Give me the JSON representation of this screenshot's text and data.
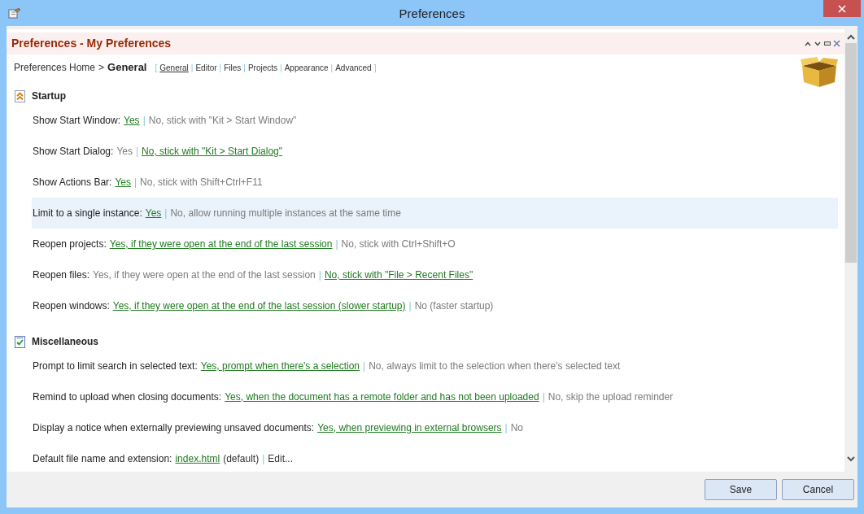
{
  "window": {
    "title": "Preferences"
  },
  "panel": {
    "title": "Preferences - My Preferences"
  },
  "breadcrumb": {
    "home": "Preferences Home",
    "separator": ">",
    "current": "General"
  },
  "nav": {
    "open": "[",
    "close": "]",
    "separator": "|",
    "items": [
      {
        "label": "General",
        "selected": true
      },
      {
        "label": "Editor",
        "selected": false
      },
      {
        "label": "Files",
        "selected": false
      },
      {
        "label": "Projects",
        "selected": false
      },
      {
        "label": "Appearance",
        "selected": false
      },
      {
        "label": "Advanced",
        "selected": false
      }
    ]
  },
  "sections": [
    {
      "title": "Startup",
      "kind": "collapse",
      "rows": [
        {
          "label": "Show Start Window:",
          "highlighted": false,
          "parts": [
            {
              "kind": "option",
              "text": "Yes",
              "selected": true
            },
            {
              "kind": "sep",
              "text": "|"
            },
            {
              "kind": "option",
              "text": "No, stick with \"Kit > Start Window\"",
              "selected": false
            }
          ]
        },
        {
          "label": "Show Start Dialog:",
          "highlighted": false,
          "parts": [
            {
              "kind": "option",
              "text": "Yes",
              "selected": false
            },
            {
              "kind": "sep",
              "text": "|"
            },
            {
              "kind": "option",
              "text": "No, stick with \"Kit > Start Dialog\"",
              "selected": true
            }
          ]
        },
        {
          "label": "Show Actions Bar:",
          "highlighted": false,
          "parts": [
            {
              "kind": "option",
              "text": "Yes",
              "selected": true
            },
            {
              "kind": "sep",
              "text": "|"
            },
            {
              "kind": "option",
              "text": "No, stick with Shift+Ctrl+F11",
              "selected": false
            }
          ]
        },
        {
          "label": "Limit to a single instance:",
          "highlighted": true,
          "parts": [
            {
              "kind": "option",
              "text": "Yes",
              "selected": true
            },
            {
              "kind": "sep",
              "text": "|"
            },
            {
              "kind": "option",
              "text": "No, allow running multiple instances at the same time",
              "selected": false
            }
          ]
        },
        {
          "label": "Reopen projects:",
          "highlighted": false,
          "parts": [
            {
              "kind": "option",
              "text": "Yes, if they were open at the end of the last session",
              "selected": true
            },
            {
              "kind": "sep",
              "text": "|"
            },
            {
              "kind": "option",
              "text": "No, stick with Ctrl+Shift+O",
              "selected": false
            }
          ]
        },
        {
          "label": "Reopen files:",
          "highlighted": false,
          "parts": [
            {
              "kind": "option",
              "text": "Yes, if they were open at the end of the last session",
              "selected": false
            },
            {
              "kind": "sep",
              "text": "|"
            },
            {
              "kind": "option",
              "text": "No, stick with \"File > Recent Files\"",
              "selected": true
            }
          ]
        },
        {
          "label": "Reopen windows:",
          "highlighted": false,
          "parts": [
            {
              "kind": "option",
              "text": "Yes, if they were open at the end of the last session (slower startup)",
              "selected": true
            },
            {
              "kind": "sep",
              "text": "|"
            },
            {
              "kind": "option",
              "text": "No (faster startup)",
              "selected": false
            }
          ]
        }
      ]
    },
    {
      "title": "Miscellaneous",
      "kind": "checklist",
      "rows": [
        {
          "label": "Prompt to limit search in selected text:",
          "highlighted": false,
          "parts": [
            {
              "kind": "option",
              "text": "Yes, prompt when there's a selection",
              "selected": true
            },
            {
              "kind": "sep",
              "text": "|"
            },
            {
              "kind": "option",
              "text": "No, always limit to the selection when there's selected text",
              "selected": false
            }
          ]
        },
        {
          "label": "Remind to upload when closing documents:",
          "highlighted": false,
          "parts": [
            {
              "kind": "option",
              "text": "Yes, when the document has a remote folder and has not been uploaded",
              "selected": true
            },
            {
              "kind": "sep",
              "text": "|"
            },
            {
              "kind": "option",
              "text": "No, skip the upload reminder",
              "selected": false
            }
          ]
        },
        {
          "label": "Display a notice when externally previewing unsaved documents:",
          "highlighted": false,
          "parts": [
            {
              "kind": "option",
              "text": "Yes, when previewing in external browsers",
              "selected": true
            },
            {
              "kind": "sep",
              "text": "|"
            },
            {
              "kind": "option",
              "text": "No",
              "selected": false
            }
          ]
        },
        {
          "label": "Default file name and extension:",
          "highlighted": false,
          "parts": [
            {
              "kind": "option",
              "text": "index.html",
              "selected": true
            },
            {
              "kind": "note",
              "text": "(default)"
            },
            {
              "kind": "sep",
              "text": "|"
            },
            {
              "kind": "action",
              "text": "Edit..."
            }
          ]
        }
      ]
    }
  ],
  "buttons": [
    "Save",
    "Cancel"
  ]
}
